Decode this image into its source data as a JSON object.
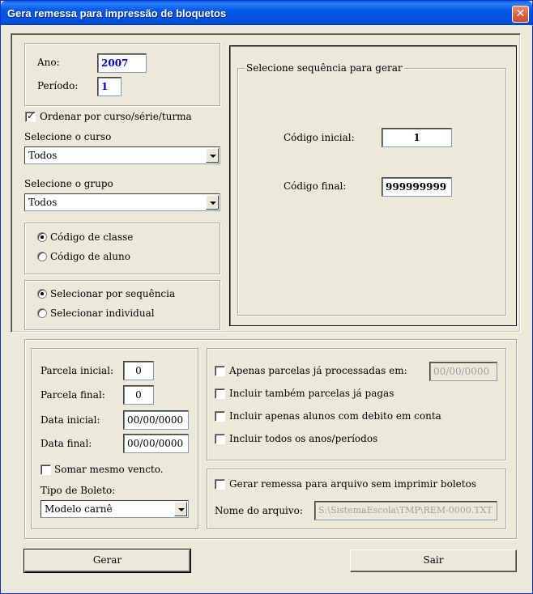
{
  "window": {
    "title": "Gera remessa para impressão de bloquetos",
    "close_glyph": "✕"
  },
  "year_period": {
    "ano_label": "Ano:",
    "ano_value": "2007",
    "periodo_label": "Período:",
    "periodo_value": "1"
  },
  "ordenar": {
    "label": "Ordenar por curso/série/turma",
    "checked": true
  },
  "curso": {
    "label": "Selecione o curso",
    "value": "Todos"
  },
  "grupo": {
    "label": "Selecione o grupo",
    "value": "Todos"
  },
  "codigo_tipo": {
    "options": [
      "Código de classe",
      "Código de aluno"
    ],
    "selected": 0
  },
  "selecao_tipo": {
    "options": [
      "Selecionar por sequência",
      "Selecionar individual"
    ],
    "selected": 0
  },
  "sequencia": {
    "legend": "Selecione sequência para gerar",
    "inicial_label": "Código inicial:",
    "inicial_value": "1",
    "final_label": "Código final:",
    "final_value": "999999999"
  },
  "parcelas": {
    "inicial_label": "Parcela inicial:",
    "inicial_value": "0",
    "final_label": "Parcela final:",
    "final_value": "0",
    "data_inicial_label": "Data inicial:",
    "data_inicial_value": "00/00/0000",
    "data_final_label": "Data final:",
    "data_final_value": "00/00/0000",
    "somar_label": "Somar mesmo vencto.",
    "tipo_label": "Tipo de Boleto:",
    "tipo_value": "Modelo carnê"
  },
  "opcoes": {
    "apenas_processadas_label": "Apenas parcelas já processadas em:",
    "apenas_processadas_date": "00/00/0000",
    "incluir_pagas_label": "Incluir também parcelas já pagas",
    "incluir_debito_label": "Incluir apenas alunos com debito em conta",
    "incluir_todos_label": "Incluir todos os anos/períodos"
  },
  "arquivo": {
    "gerar_label": "Gerar remessa para arquivo sem imprimir boletos",
    "nome_label": "Nome do arquivo:",
    "nome_value": "S:\\SistemaEscola\\TMP\\REM-0000.TXT"
  },
  "buttons": {
    "gerar": "Gerar",
    "sair": "Sair"
  }
}
